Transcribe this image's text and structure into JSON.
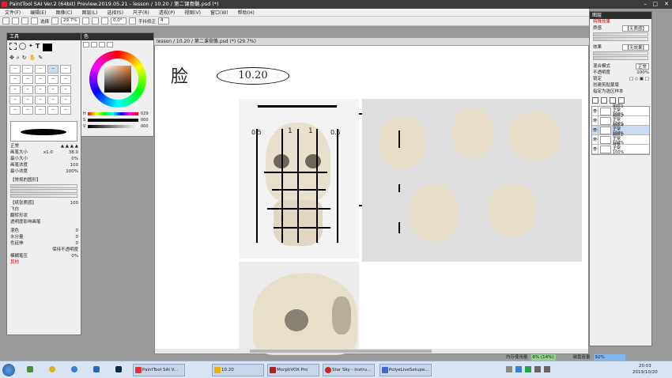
{
  "app": {
    "title": "PaintTool SAI Ver.2 (64bit) Preview.2019.05.21 - lesson / 10.20 / 第二课骨骼.psd (*)"
  },
  "menu": {
    "items": [
      "文件(F)",
      "编辑(E)",
      "图像(C)",
      "图层(L)",
      "选择(S)",
      "尺子(R)",
      "透视(P)",
      "视图(V)",
      "窗口(W)",
      "帮助(H)"
    ]
  },
  "toolbar": {
    "selection_label": "选择",
    "zoom_value": "29.7%",
    "rotation_value": "0.0°",
    "stabilizer_label": "手抖修正",
    "stabilizer_value": "4"
  },
  "tools_panel": {
    "title": "工具",
    "brush_mode": "正常",
    "brush_size_label": "画笔大小",
    "brush_size_multiplier": "x1.0",
    "brush_size_value": "38.0",
    "min_size_label": "最小大小",
    "min_size_value": "0%",
    "density_label": "画笔浓度",
    "density_value": "100",
    "min_density_label": "最小浓度",
    "min_density_value": "100%",
    "shape_section": "【常规的圆形】",
    "texture_section": "【纸张质感】",
    "texture_value": "100",
    "check_blend": "飞白",
    "check_flip": "翻转形状",
    "check_transparent": "透明度影响画笔",
    "blend_label": "混色",
    "blend_value": "0",
    "water_label": "水分量",
    "water_value": "0",
    "color_extend_label": "色延伸",
    "color_extend_value": "0",
    "keep_opacity_label": "保持不透明度",
    "blur_pressure_label": "模糊笔压",
    "blur_pressure_value": "0%",
    "other_label": "其他"
  },
  "color_panel": {
    "title": "色",
    "h_label": "H",
    "h_value": "029",
    "s_label": "S",
    "s_value": "000",
    "v_label": "V",
    "v_value": "000"
  },
  "canvas": {
    "tab_title": "lesson / 10.20 / 第二课骨骼.psd (*) (29.7%)",
    "handwriting_char": "脸",
    "handwriting_date": "10.20",
    "grid_labels": [
      "0.5",
      "1",
      "1",
      "0.5"
    ]
  },
  "layers_panel": {
    "title": "图层",
    "special_effect": "特殊效果",
    "texture_label": "质感",
    "texture_value": "【无质感】",
    "effect_label": "效果",
    "effect_value": "【无效果】",
    "blend_mode_label": "混合模式",
    "blend_mode_value": "正常",
    "opacity_label": "不透明度",
    "opacity_value": "100%",
    "lock_label": "锁定",
    "clip_label": "创建剪贴蒙版",
    "select_source_label": "指定为选区样本",
    "layers": [
      {
        "name": "图层3",
        "mode": "正常",
        "opacity": "100%"
      },
      {
        "name": "图层2",
        "mode": "正常",
        "opacity": "100%"
      },
      {
        "name": "图层4",
        "mode": "正常",
        "opacity": "100%"
      },
      {
        "name": "图层1",
        "mode": "正常",
        "opacity": "100%"
      },
      {
        "name": "背景",
        "mode": "正常",
        "opacity": "100%"
      }
    ]
  },
  "status": {
    "memory_label": "内存使用量",
    "memory_value": "6% (14%)",
    "disk_label": "磁盘容量",
    "disk_value": "92%"
  },
  "taskbar": {
    "apps": [
      {
        "label": "PaintTool SAI V...",
        "color": "#d33"
      },
      {
        "label": "10.20",
        "color": "#e8b400"
      },
      {
        "label": "MorphVOX Pro",
        "color": "#a22"
      },
      {
        "label": "Star Sky - Instru...",
        "color": "#c22"
      },
      {
        "label": "PolyeLiveSetupe...",
        "color": "#4466cc"
      }
    ],
    "time": "20:03",
    "date": "2019/10/20"
  }
}
